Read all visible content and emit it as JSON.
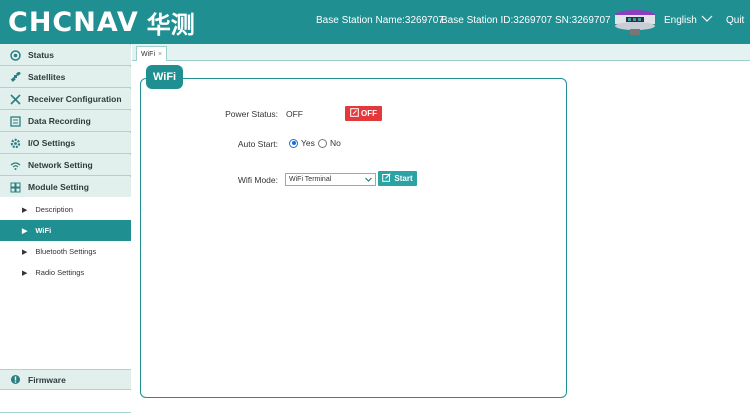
{
  "header": {
    "logo_latin": "CHCNAV",
    "logo_cn": "华测",
    "base_station_name": "Base Station Name:3269707",
    "base_station_id": "Base Station ID:3269707",
    "sn": "SN:3269707",
    "language": "English",
    "quit": "Quit"
  },
  "sidebar": {
    "items": [
      {
        "label": "Status",
        "icon": "status-icon"
      },
      {
        "label": "Satellites",
        "icon": "satellite-icon"
      },
      {
        "label": "Receiver Configuration",
        "icon": "tools-icon"
      },
      {
        "label": "Data Recording",
        "icon": "recording-icon"
      },
      {
        "label": "I/O Settings",
        "icon": "gear-icon"
      },
      {
        "label": "Network Setting",
        "icon": "wifi-icon"
      },
      {
        "label": "Module Setting",
        "icon": "modules-icon"
      }
    ],
    "sub_items": [
      {
        "label": "Description"
      },
      {
        "label": "WiFi",
        "active": true
      },
      {
        "label": "Bluetooth Settings"
      },
      {
        "label": "Radio Settings"
      }
    ],
    "firmware": {
      "label": "Firmware",
      "icon": "firmware-icon"
    }
  },
  "tabs": [
    {
      "label": "WiFi",
      "close": "×"
    }
  ],
  "panel": {
    "title": "WiFi",
    "power_status_label": "Power Status:",
    "power_status_value": "OFF",
    "off_button": "OFF",
    "auto_start_label": "Auto Start:",
    "auto_start_yes": "Yes",
    "auto_start_no": "No",
    "auto_start_selected": "Yes",
    "wifi_mode_label": "Wifi Mode:",
    "wifi_mode_value": "WiFi Terminal",
    "start_button": "Start"
  },
  "colors": {
    "brand": "#1f8f92",
    "off_red": "#e4393c",
    "sidebar_bg": "#e3f1ef"
  }
}
